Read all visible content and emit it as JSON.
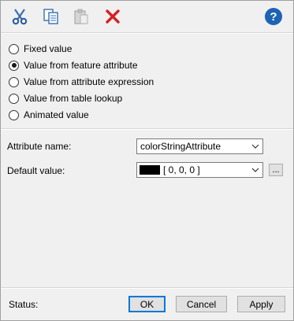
{
  "toolbar": {
    "cut_icon": "scissors-icon",
    "copy_icon": "copy-icon",
    "paste_icon": "paste-icon",
    "delete_icon": "red-x-icon",
    "help_icon": "question-mark-icon",
    "help_glyph": "?"
  },
  "options": [
    {
      "label": "Fixed value",
      "checked": false
    },
    {
      "label": "Value from feature attribute",
      "checked": true
    },
    {
      "label": "Value from attribute expression",
      "checked": false
    },
    {
      "label": "Value from table lookup",
      "checked": false
    },
    {
      "label": "Animated value",
      "checked": false
    }
  ],
  "attribute": {
    "label": "Attribute name:",
    "value": "colorStringAttribute"
  },
  "default": {
    "label": "Default value:",
    "value": "[ 0, 0, 0 ]",
    "swatch_color": "#000000",
    "browse_label": "..."
  },
  "footer": {
    "status_label": "Status:",
    "ok_label": "OK",
    "cancel_label": "Cancel",
    "apply_label": "Apply"
  },
  "colors": {
    "delete_red": "#d42020",
    "help_blue": "#1d63b3",
    "focus_blue": "#0078d7"
  }
}
